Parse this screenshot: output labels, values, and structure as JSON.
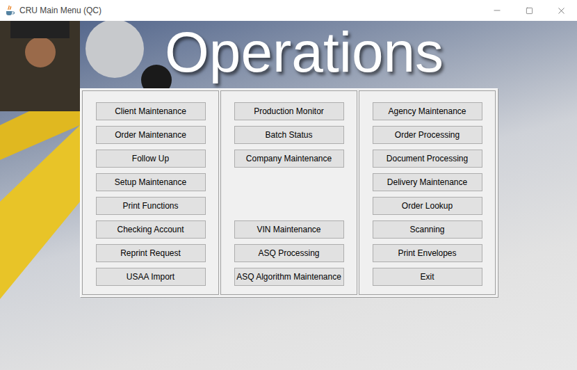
{
  "window": {
    "title": "CRU Main Menu (QC)"
  },
  "heading": "Operations",
  "columns": [
    {
      "groups": [
        [
          "Client Maintenance",
          "Order Maintenance",
          "Follow Up",
          "Setup Maintenance",
          "Print Functions",
          "Checking Account",
          "Reprint Request",
          "USAA Import"
        ]
      ]
    },
    {
      "groups": [
        [
          "Production Monitor",
          "Batch Status",
          "Company Maintenance"
        ],
        [
          "VIN Maintenance",
          "ASQ Processing",
          "ASQ Algorithm Maintenance"
        ]
      ]
    },
    {
      "groups": [
        [
          "Agency Maintenance",
          "Order Processing",
          "Document Processing",
          "Delivery Maintenance",
          "Order Lookup",
          "Scanning",
          "Print Envelopes",
          "Exit"
        ]
      ]
    }
  ]
}
